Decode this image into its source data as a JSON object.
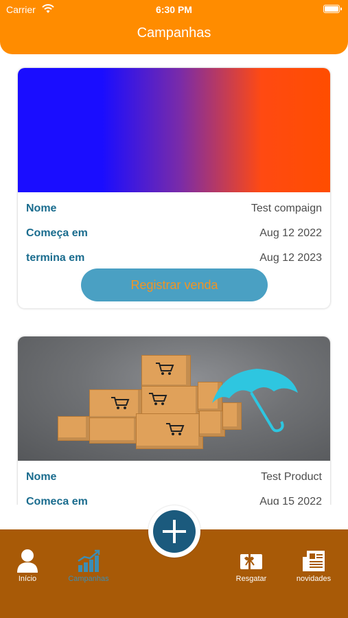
{
  "status_bar": {
    "carrier": "Carrier",
    "time": "6:30 PM"
  },
  "header": {
    "title": "Campanhas"
  },
  "campaigns": [
    {
      "image": "gradient-banner",
      "name_label": "Nome",
      "name_value": "Test compaign",
      "start_label": "Começa em",
      "start_value": "Aug 12 2022",
      "end_label": "termina em",
      "end_value": "Aug 12 2023",
      "action_label": "Registrar venda"
    },
    {
      "image": "boxes-umbrella-photo",
      "name_label": "Nome",
      "name_value": "Test Product",
      "start_label": "Começa em",
      "start_value": "Aug 15 2022"
    }
  ],
  "tabbar": {
    "tabs": [
      {
        "label": "Início",
        "icon": "user-icon"
      },
      {
        "label": "Campanhas",
        "icon": "chart-icon",
        "active": true
      },
      {
        "label": "Resgatar",
        "icon": "gift-card-icon"
      },
      {
        "label": "novidades",
        "icon": "newspaper-icon"
      }
    ],
    "fab_icon": "plus-icon"
  },
  "colors": {
    "header": "#ff8c00",
    "tabbar": "#a85a07",
    "fab": "#1b5a7d",
    "label": "#1a6c8e",
    "button_bg": "#4aa0c3",
    "button_text": "#f29423",
    "active_tab": "#3d8db3"
  }
}
